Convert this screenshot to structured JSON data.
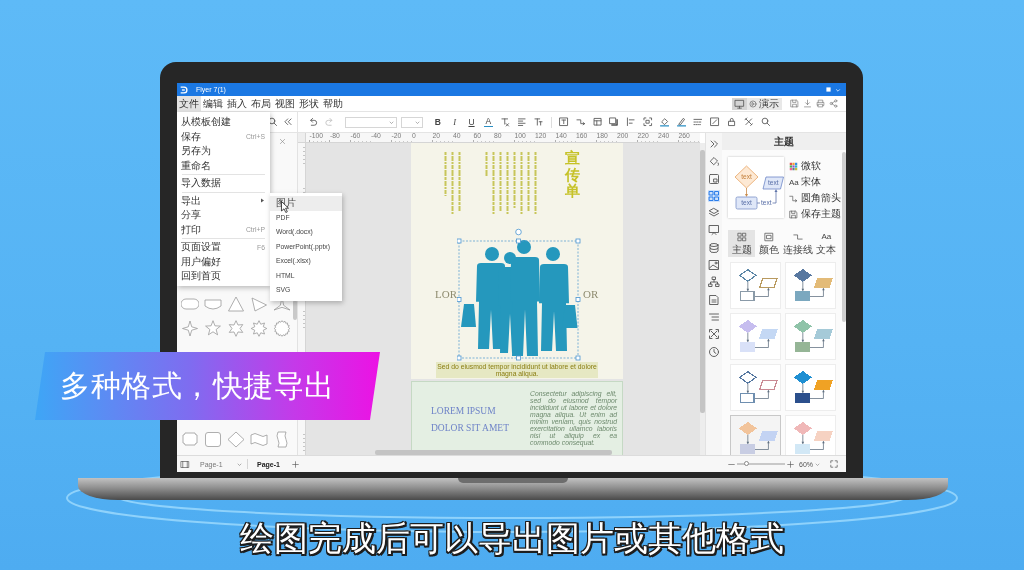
{
  "app": {
    "title": "Flyer 7(1)",
    "menu": [
      {
        "label": "文件",
        "selected": true
      },
      {
        "label": "编辑",
        "selected": false
      },
      {
        "label": "插入",
        "selected": false
      },
      {
        "label": "布局",
        "selected": false
      },
      {
        "label": "视图",
        "selected": false
      },
      {
        "label": "形状",
        "selected": false
      },
      {
        "label": "帮助",
        "selected": false
      }
    ],
    "present_button": "演示",
    "file_menu": [
      [
        {
          "label": "从模板创建"
        },
        {
          "label": "保存",
          "shortcut": "Ctrl+S"
        },
        {
          "label": "另存为"
        },
        {
          "label": "重命名"
        }
      ],
      [
        {
          "label": "导入数据"
        }
      ],
      [
        {
          "label": "导出",
          "submenu": [
            {
              "label": "图片",
              "selected": true
            },
            {
              "label": "PDF",
              "selected": false
            },
            {
              "label": "Word(.docx)",
              "selected": false
            },
            {
              "label": "PowerPoint(.pptx)",
              "selected": false
            },
            {
              "label": "Excel(.xlsx)",
              "selected": false
            },
            {
              "label": "HTML",
              "selected": false
            },
            {
              "label": "SVG",
              "selected": false
            }
          ]
        },
        {
          "label": "分享"
        },
        {
          "label": "打印",
          "shortcut": "Ctrl+P"
        }
      ],
      [
        {
          "label": "页面设置",
          "shortcut": "F6"
        },
        {
          "label": "用户偏好"
        },
        {
          "label": "回到首页"
        }
      ]
    ],
    "toolbar": {
      "undo": {
        "disabled": false
      },
      "redo": {
        "disabled": true
      },
      "format_buttons": [
        "B",
        "I",
        "U",
        "A"
      ]
    },
    "ruler_labels": [
      "-100",
      "-80",
      "-60",
      "-40",
      "-20",
      "0",
      "20",
      "40",
      "60",
      "80",
      "100",
      "120",
      "140",
      "160",
      "180",
      "200",
      "220",
      "240",
      "260"
    ],
    "flyer": {
      "title": "宣传单",
      "backdrop_left": "LOR",
      "backdrop_right": "OR",
      "caption": "Sed do eiusmod tempor incididunt ut labore et dolore magna aliqua.",
      "lower_heading": "LOREM IPSUM DOLOR SIT AMET",
      "lower_text": "Consectetur adipiscing elit, sed do eiusmod tempor incididunt ut labore et dolore magna aliqua. Ut enim ad minim veniam, quis nostrud exercitation ullamco laboris nisi ut aliquip ex ea commodo consequat."
    },
    "tool_rail": [
      {
        "selected": false
      },
      {
        "selected": false
      },
      {
        "selected": true
      },
      {
        "selected": false
      },
      {
        "selected": false
      },
      {
        "selected": false
      },
      {
        "selected": false
      },
      {
        "selected": false
      },
      {
        "selected": false
      },
      {
        "selected": false
      },
      {
        "selected": false
      },
      {
        "selected": false
      }
    ],
    "theme_panel": {
      "title": "主题",
      "preview_labels": [
        "text",
        "text",
        "text",
        "text"
      ],
      "options": [
        {
          "label": "微软"
        },
        {
          "label": "宋体",
          "glyph": "Aa"
        },
        {
          "label": "圆角箭头"
        },
        {
          "label": "保存主题"
        }
      ],
      "tabs": [
        {
          "label": "主题",
          "selected": true
        },
        {
          "label": "颜色",
          "selected": false
        },
        {
          "label": "连接线",
          "selected": false
        },
        {
          "label": "文本",
          "glyph": "Aa",
          "selected": false
        }
      ],
      "themes": [
        {
          "selected": false,
          "filled": false,
          "swatches": [
            {
              "color": "#5b86a6"
            },
            {
              "color": "#8a9aa8"
            },
            {
              "color": "#b99a5f"
            }
          ]
        },
        {
          "selected": false,
          "filled": true,
          "swatches": [
            {
              "color": "#5878a0"
            },
            {
              "color": "#7ba8bf"
            },
            {
              "color": "#e3bb78"
            }
          ]
        },
        {
          "selected": false,
          "filled": true,
          "swatches": [
            {
              "color": "#c6bdef"
            },
            {
              "color": "#d9e1f8"
            },
            {
              "color": "#c4d8f4"
            }
          ]
        },
        {
          "selected": false,
          "filled": true,
          "swatches": [
            {
              "color": "#8fc3a8"
            },
            {
              "color": "#95b596"
            },
            {
              "color": "#a5cad8"
            }
          ]
        },
        {
          "selected": false,
          "filled": false,
          "swatches": [
            {
              "color": "#5577a0"
            },
            {
              "color": "#6f8fb0"
            },
            {
              "color": "#c98a94"
            }
          ]
        },
        {
          "selected": false,
          "filled": true,
          "swatches": [
            {
              "color": "#1f8fd2"
            },
            {
              "color": "#2b4f8c"
            },
            {
              "color": "#f0a224"
            }
          ]
        },
        {
          "selected": true,
          "filled": true,
          "swatches": [
            {
              "color": "#f2c49b"
            },
            {
              "color": "#c8cde3"
            },
            {
              "color": "#c3d3f3"
            }
          ]
        },
        {
          "selected": false,
          "filled": true,
          "swatches": [
            {
              "color": "#f0b8b8"
            },
            {
              "color": "#d2e8f6"
            },
            {
              "color": "#f6d2c2"
            }
          ]
        }
      ]
    },
    "status_bar": {
      "page_select": "Page-1",
      "pages": [
        {
          "label": "Page-1",
          "selected": true
        }
      ],
      "zoom": {
        "level": 0.2,
        "value": "60%"
      }
    }
  },
  "overlay": {
    "banner": "多种格式，快捷导出",
    "subtitle": "绘图完成后可以导出图片或其他格式"
  }
}
